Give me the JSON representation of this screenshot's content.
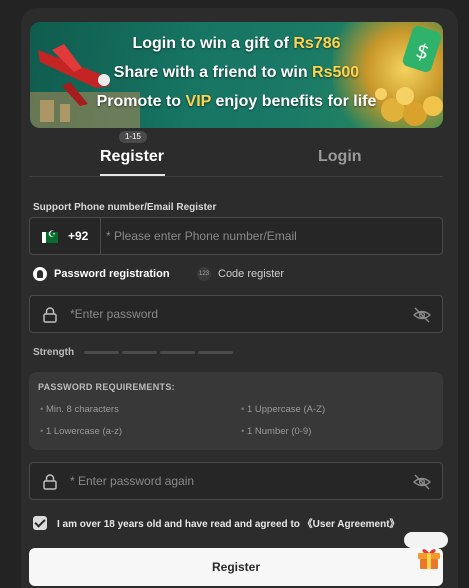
{
  "banner": {
    "line1_prefix": "Login to win a gift of ",
    "line1_amount": "Rs786",
    "line2_prefix": "Share with a friend to win ",
    "line2_amount": "Rs500",
    "line3_prefix": "Promote to ",
    "line3_vip": "VIP",
    "line3_suffix": " enjoy benefits for life"
  },
  "tabs": {
    "badge": "1-15",
    "register_label": "Register",
    "login_label": "Login"
  },
  "form": {
    "phone_label": "Support Phone number/Email Register",
    "country_code": "+92",
    "phone_placeholder": "* Please enter Phone number/Email",
    "option_password": "Password registration",
    "option_code": "Code register",
    "option_code_icon_text": "123",
    "password_placeholder": "*Enter password",
    "strength_label": "Strength",
    "strength_level": 0,
    "requirements_title": "PASSWORD REQUIREMENTS:",
    "requirements": [
      "Min. 8 characters",
      "1 Uppercase (A-Z)",
      "1 Lowercase (a-z)",
      "1 Number (0-9)"
    ],
    "password_again_placeholder": "* Enter password again",
    "agree_text": "I am over 18 years old and have read and agreed to 《User Agreement》",
    "agree_checked": true,
    "register_button": "Register"
  },
  "colors": {
    "background": "#232323",
    "panel": "#2c2c2c",
    "accent_gold": "#ffd34d",
    "button_bg": "#f7f7f7"
  },
  "icons": [
    "pakistan-flag-icon",
    "lock-icon",
    "eye-off-icon",
    "checkmark-icon",
    "gift-icon"
  ]
}
